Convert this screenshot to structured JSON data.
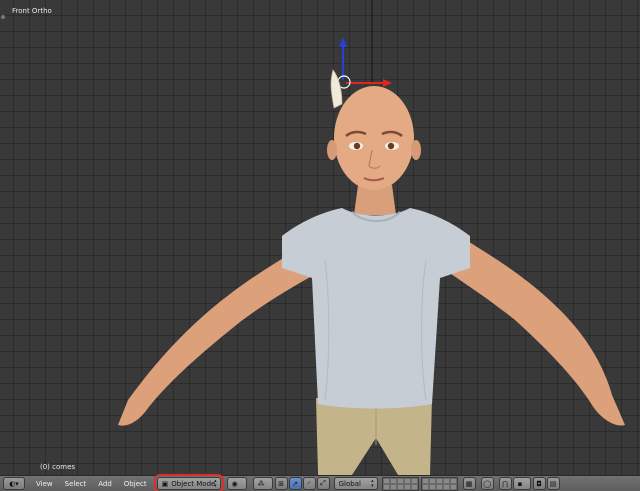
{
  "viewport": {
    "view_label": "Front Ortho",
    "object_info": "(0) comes"
  },
  "header": {
    "menus": [
      "View",
      "Select",
      "Add",
      "Object"
    ],
    "mode_selector": "Object Mode",
    "orientation_selector": "Global",
    "mode_selector_highlighted": true
  },
  "colors": {
    "viewport_bg": "#393939",
    "header_bg": "#686868",
    "highlight": "#d9302a",
    "axis_x": "#e0261f",
    "axis_z": "#2a3fd6",
    "shirt": "#c7cdd4",
    "pants": "#c4b48a",
    "skin": "#e0a782"
  },
  "icons": {
    "editor_type": "view3d-icon",
    "pivot": "pivot-icon",
    "snap": "magnet-icon",
    "render": "camera-icon"
  }
}
